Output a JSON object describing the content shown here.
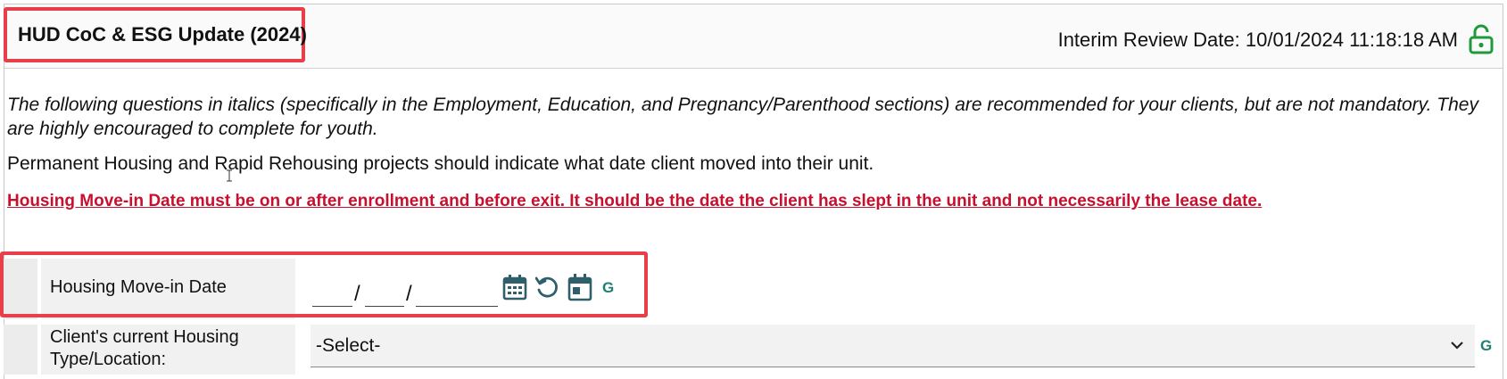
{
  "header": {
    "title": "HUD CoC & ESG Update (2024)",
    "review_date": "Interim Review Date: 10/01/2024 11:18:18 AM",
    "lock_icon": "unlock-icon"
  },
  "intro_text": "The following questions in italics (specifically in the Employment, Education, and Pregnancy/Parenthood sections) are recommended for your clients, but are not mandatory. They are highly encouraged to complete for youth.",
  "info_text": "Permanent Housing and Rapid Rehousing projects should indicate what date client moved into their unit.",
  "warning_text": "Housing Move-in Date must be on or after enrollment and before exit. It should be the date the client has slept in the unit and not necessarily the lease date.",
  "fields": {
    "move_in_date": {
      "label": "Housing Move-in Date",
      "month": "",
      "day": "",
      "year": "",
      "separator": "/",
      "badge": "G"
    },
    "housing_type": {
      "label": "Client's current Housing Type/Location:",
      "selected": "-Select-",
      "badge": "G"
    }
  },
  "colors": {
    "accent_green": "#1f7f75",
    "warning_red": "#c8102e",
    "highlight_red": "#e8404a",
    "icon_teal": "#2f5f6b"
  }
}
